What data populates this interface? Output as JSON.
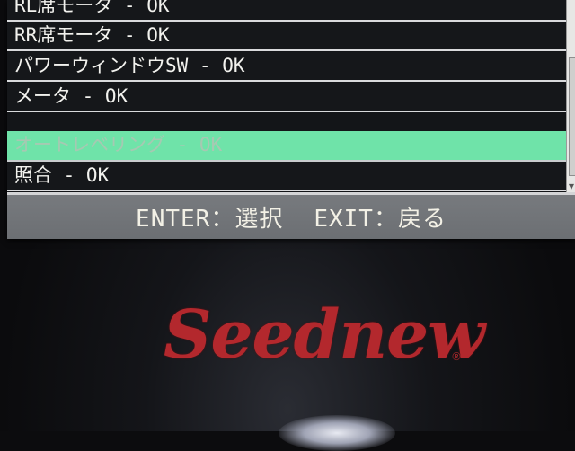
{
  "menu": {
    "items": [
      {
        "label": "RL席モータ - OK"
      },
      {
        "label": "RR席モータ - OK"
      },
      {
        "label": "パワーウィンドウSW - OK"
      },
      {
        "label": "メータ - OK"
      },
      {
        "label": "オートレベリング - OK"
      },
      {
        "label": "照合 - OK"
      }
    ],
    "selected_index": 4
  },
  "footer": {
    "enter_text": "ENTER：選択",
    "exit_text": "EXIT：戻る"
  },
  "brand": {
    "logo_text": "Seednew",
    "logo_mark": "®",
    "logo_color": "#b3282d"
  },
  "colors": {
    "highlight": "#6fe3a9",
    "footer_bg": "#777a7e"
  }
}
